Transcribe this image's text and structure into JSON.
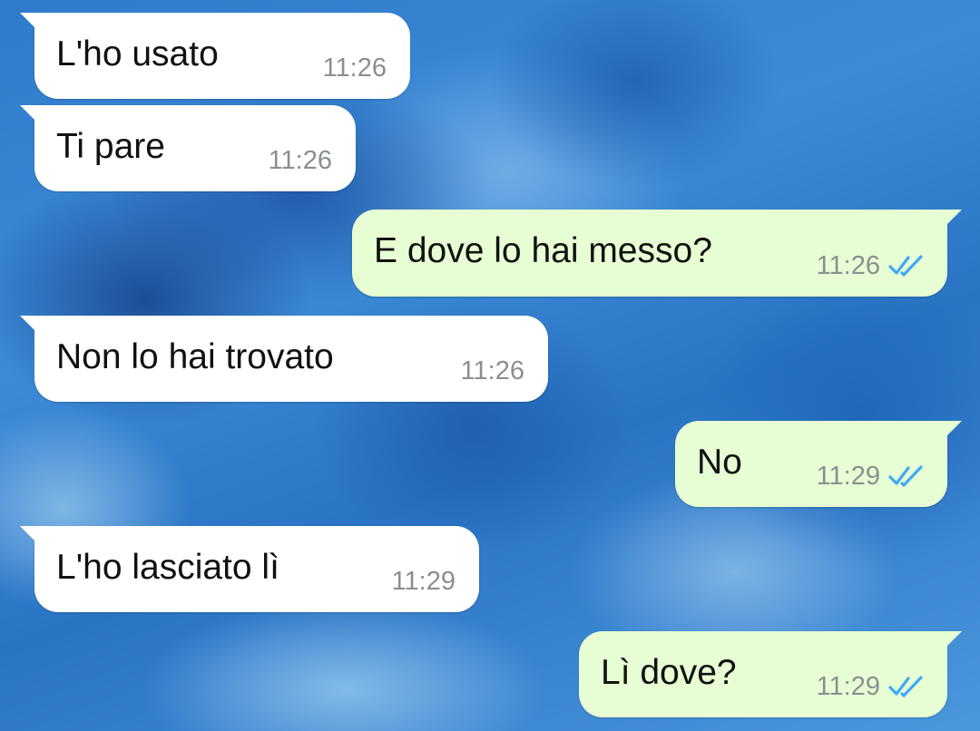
{
  "messages": [
    {
      "direction": "incoming",
      "text": "L'ho usato",
      "time": "11:26"
    },
    {
      "direction": "incoming",
      "text": "Ti pare",
      "time": "11:26"
    },
    {
      "direction": "outgoing",
      "text": "E dove lo hai messo?",
      "time": "11:26",
      "status_icon": "double-check-read-icon"
    },
    {
      "direction": "incoming",
      "text": "Non lo hai trovato",
      "time": "11:26"
    },
    {
      "direction": "outgoing",
      "text": "No",
      "time": "11:29",
      "status_icon": "double-check-read-icon"
    },
    {
      "direction": "incoming",
      "text": "L'ho lasciato lì",
      "time": "11:29"
    },
    {
      "direction": "outgoing",
      "text": "Lì dove?",
      "time": "11:29",
      "status_icon": "double-check-read-icon"
    }
  ],
  "colors": {
    "incoming_bubble": "#ffffff",
    "outgoing_bubble": "#e7fdd3",
    "read_check": "#3fa9f5",
    "timestamp": "#8a8f93",
    "wallpaper": "#3d8bd6"
  }
}
